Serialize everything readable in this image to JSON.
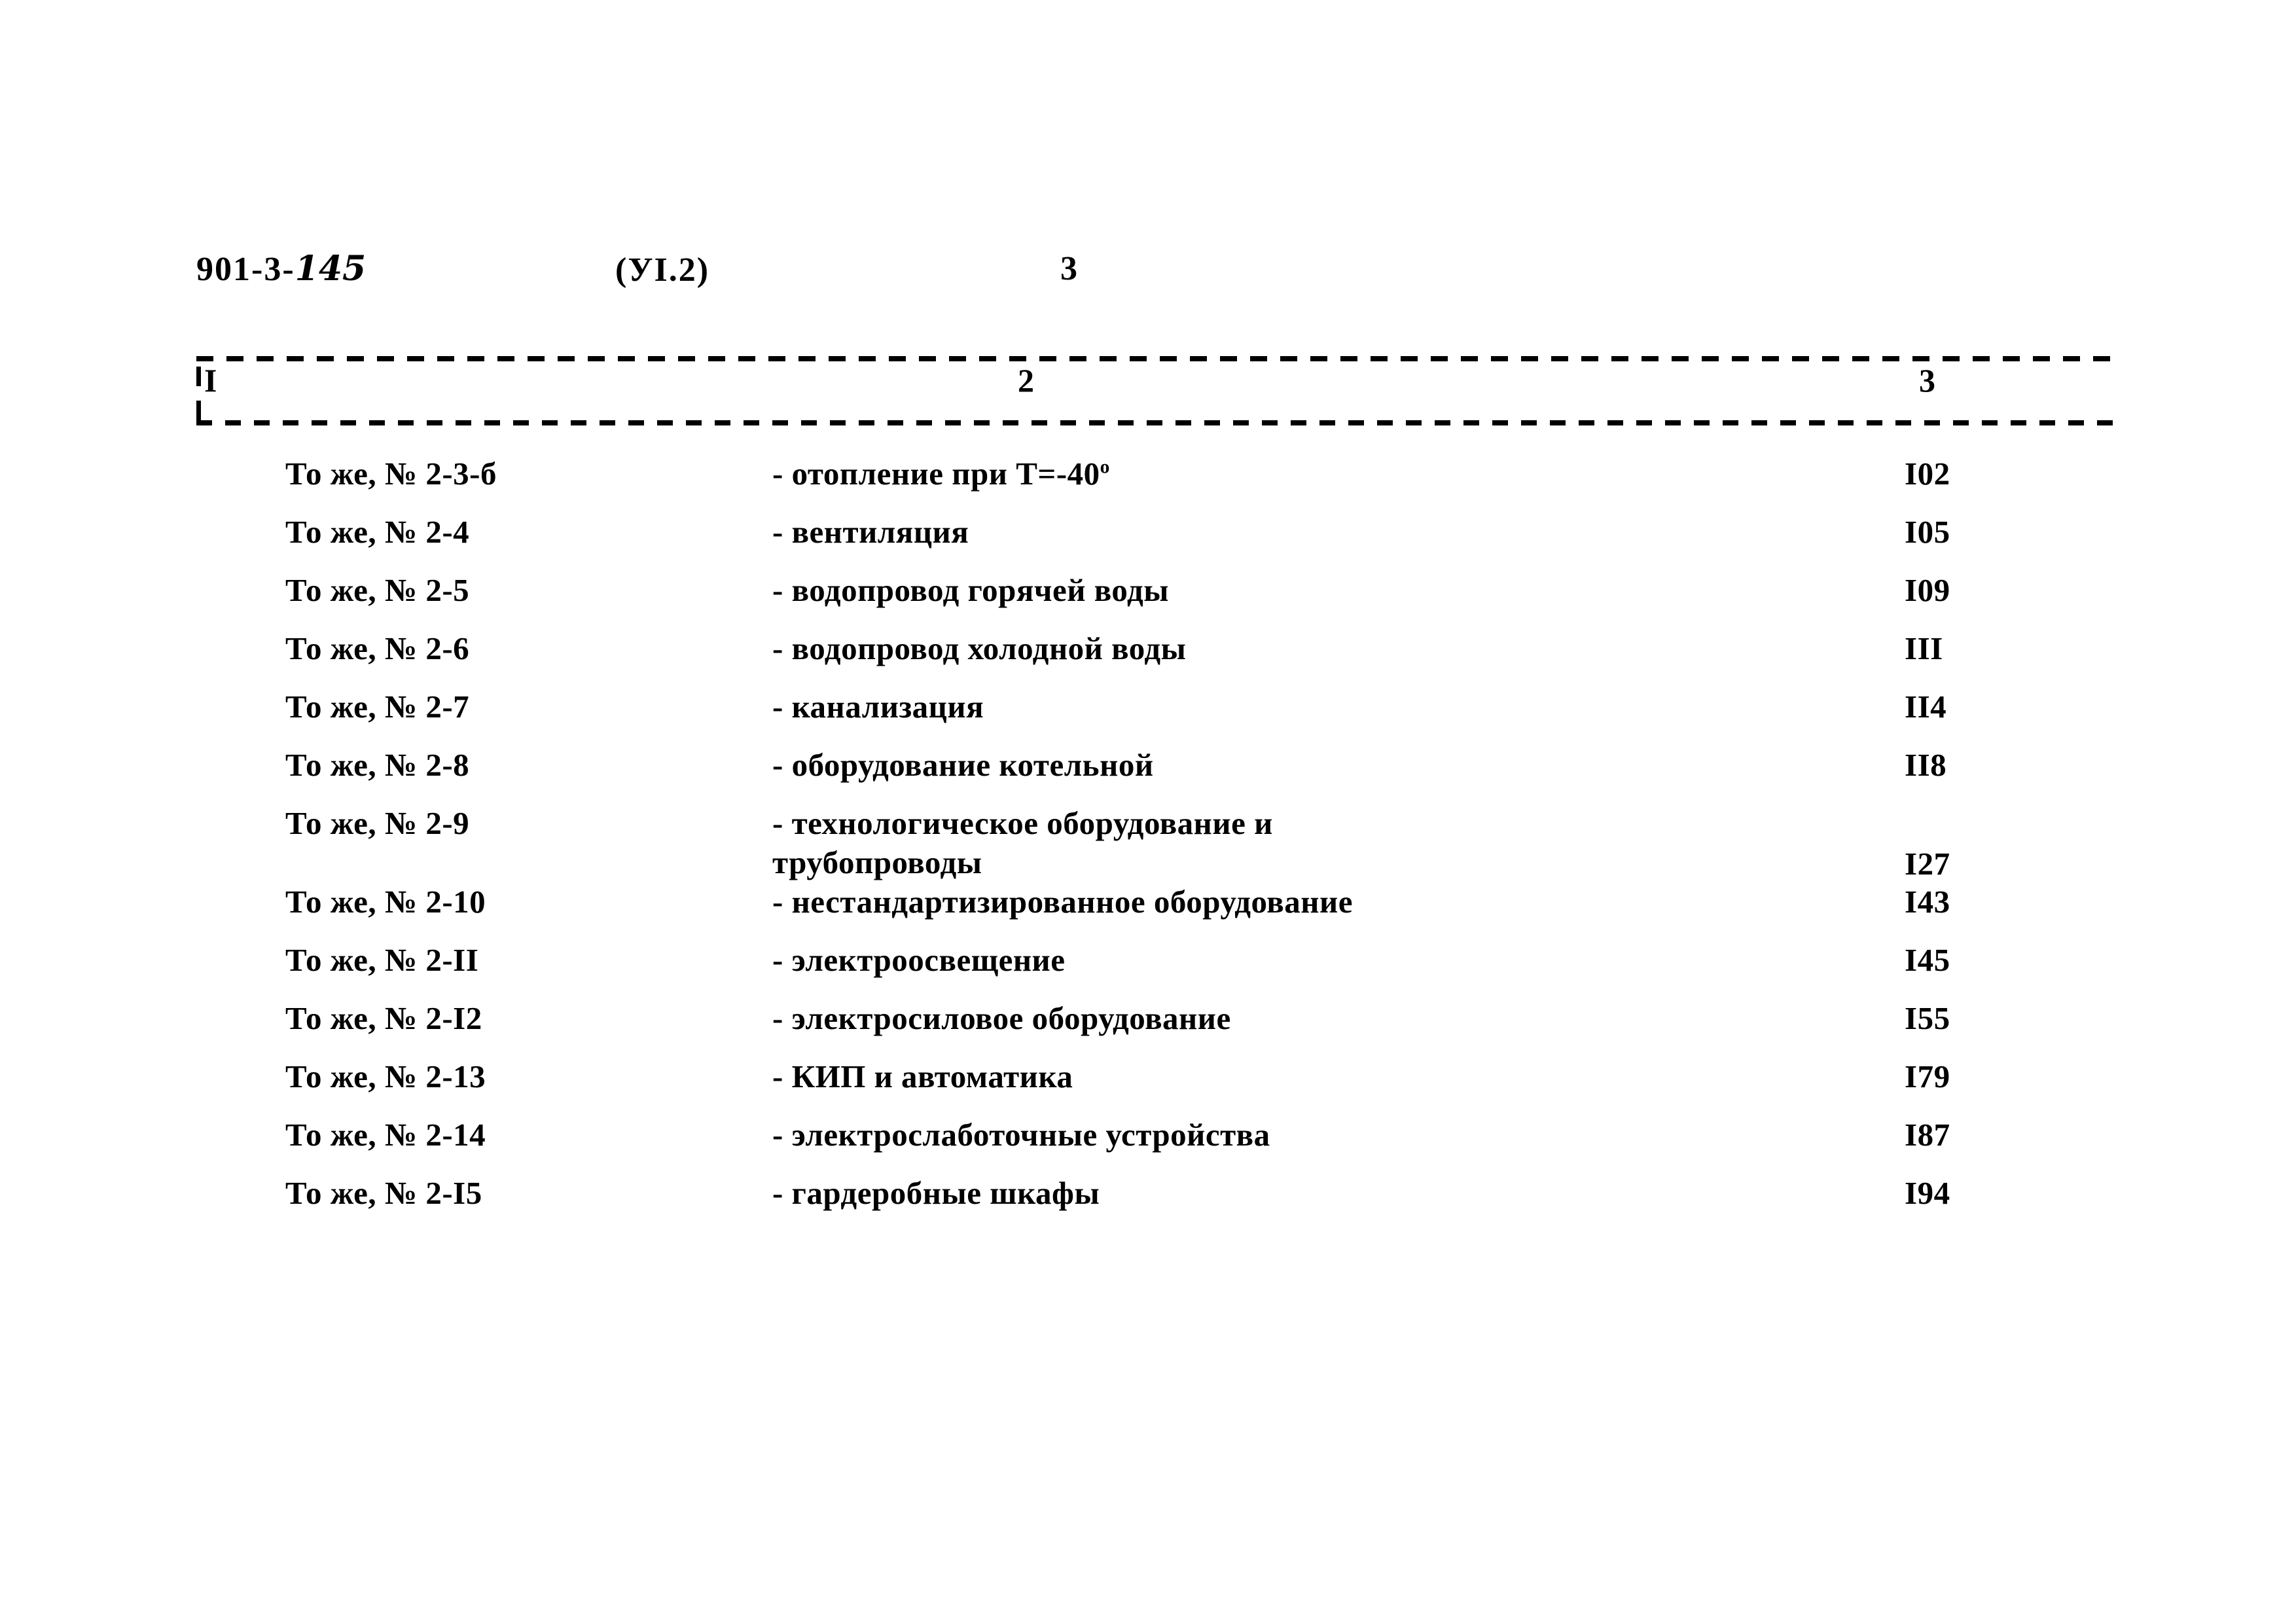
{
  "header": {
    "doc_code_prefix": "901-3-",
    "doc_code_suffix": "145",
    "series": "(УI.2)",
    "page_number": "3"
  },
  "table": {
    "column_headers": [
      "I",
      "2",
      "3"
    ],
    "rows": [
      {
        "ref": "То же, № 2-3-б",
        "desc": "- отопление при Т=-40",
        "desc_sup": "о",
        "desc_line2": "",
        "page": "I02"
      },
      {
        "ref": "То же, № 2-4",
        "desc": "- вентиляция",
        "desc_sup": "",
        "desc_line2": "",
        "page": "I05"
      },
      {
        "ref": "То же, № 2-5",
        "desc": "- водопровод горячей воды",
        "desc_sup": "",
        "desc_line2": "",
        "page": "I09"
      },
      {
        "ref": "То же, № 2-6",
        "desc": "- водопровод холодной воды",
        "desc_sup": "",
        "desc_line2": "",
        "page": "III"
      },
      {
        "ref": "То же, № 2-7",
        "desc": "- канализация",
        "desc_sup": "",
        "desc_line2": "",
        "page": "II4"
      },
      {
        "ref": "То же, № 2-8",
        "desc": "- оборудование котельной",
        "desc_sup": "",
        "desc_line2": "",
        "page": "II8"
      },
      {
        "ref": "То же, № 2-9",
        "desc": "- технологическое оборудование и",
        "desc_sup": "",
        "desc_line2": "трубопроводы",
        "page": "I27"
      },
      {
        "ref": "То же, № 2-10",
        "desc": "- нестандартизированное оборудование",
        "desc_sup": "",
        "desc_line2": "",
        "page": "I43"
      },
      {
        "ref": "То же, № 2-II",
        "desc": "- электроосвещение",
        "desc_sup": "",
        "desc_line2": "",
        "page": "I45"
      },
      {
        "ref": "То же, № 2-I2",
        "desc": "- электросиловое оборудование",
        "desc_sup": "",
        "desc_line2": "",
        "page": "I55"
      },
      {
        "ref": "То же, № 2-13",
        "desc": "- КИП и автоматика",
        "desc_sup": "",
        "desc_line2": "",
        "page": "I79"
      },
      {
        "ref": "То же, № 2-14",
        "desc": "- электрослаботочные устройства",
        "desc_sup": "",
        "desc_line2": "",
        "page": "I87"
      },
      {
        "ref": "То же, № 2-I5",
        "desc": "- гардеробные шкафы",
        "desc_sup": "",
        "desc_line2": "",
        "page": "I94"
      }
    ]
  }
}
